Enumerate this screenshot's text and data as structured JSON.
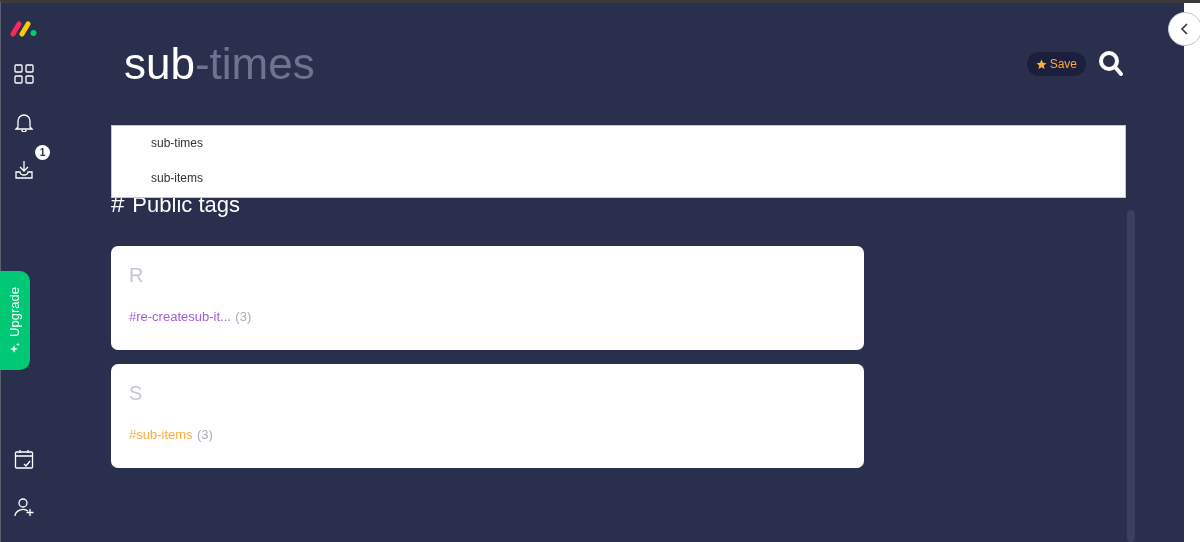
{
  "sidebar": {
    "items": [
      {
        "kind": "apps"
      },
      {
        "kind": "bell"
      },
      {
        "kind": "inbox",
        "badge": "1"
      }
    ],
    "upgrade": "Upgrade",
    "bottom_items": [
      {
        "kind": "calendar"
      },
      {
        "kind": "invite"
      }
    ]
  },
  "search": {
    "value": "sub",
    "completion": "-times",
    "save": "Save"
  },
  "suggestions": [
    "sub-times",
    "sub-items"
  ],
  "heading": {
    "icon": "#",
    "text": "Public tags"
  },
  "groups": [
    {
      "letter": "R",
      "tags": [
        {
          "name": "#re-createsub-it...",
          "count": "(3)",
          "color": "#a25ddc"
        }
      ]
    },
    {
      "letter": "S",
      "tags": [
        {
          "name": "#sub-items",
          "count": "(3)",
          "color": "#fdab3d"
        }
      ]
    }
  ]
}
